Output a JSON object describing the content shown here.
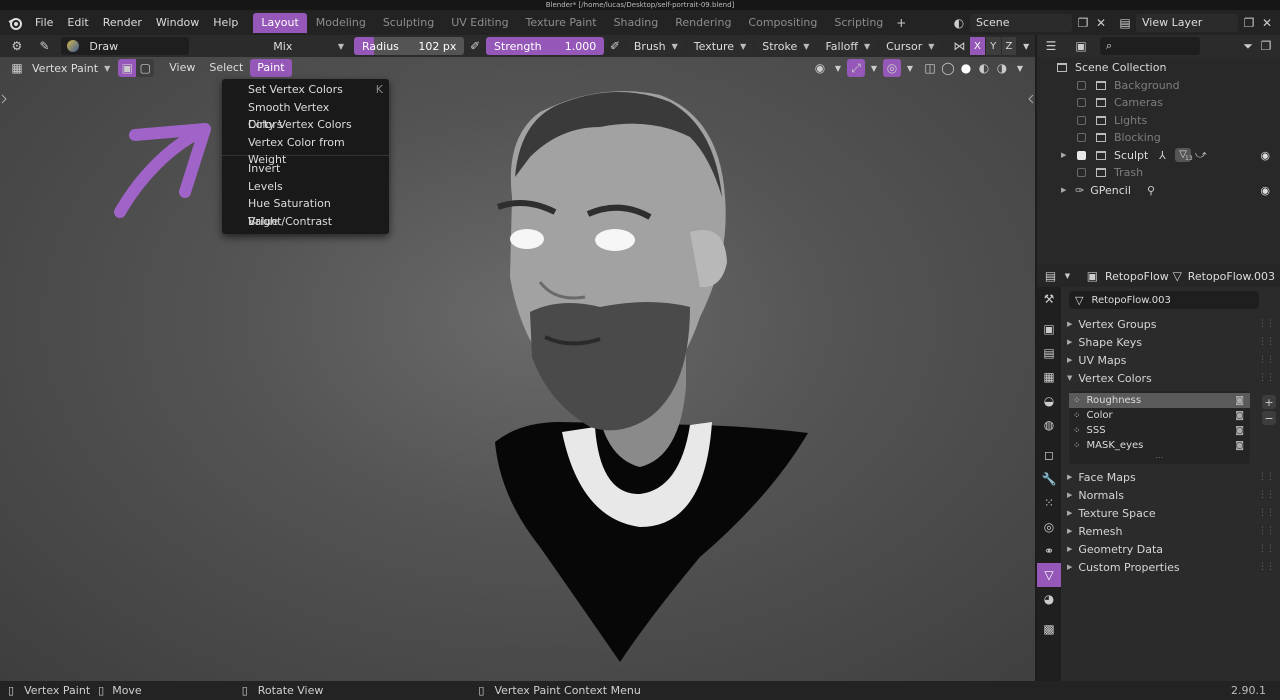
{
  "window": {
    "title": "Blender* [/home/lucas/Desktop/self-portrait-09.blend]"
  },
  "menu": [
    "File",
    "Edit",
    "Render",
    "Window",
    "Help"
  ],
  "workspaces": [
    "Layout",
    "Modeling",
    "Sculpting",
    "UV Editing",
    "Texture Paint",
    "Shading",
    "Rendering",
    "Compositing",
    "Scripting"
  ],
  "active_workspace": "Layout",
  "scene": {
    "name": "Scene",
    "view_layer": "View Layer"
  },
  "tool_settings": {
    "brush_name": "Draw",
    "blend": "Mix",
    "radius_label": "Radius",
    "radius_value": "102 px",
    "strength_label": "Strength",
    "strength_value": "1.000",
    "strength_fraction": 1.0,
    "menus": [
      "Brush",
      "Texture",
      "Stroke",
      "Falloff",
      "Cursor"
    ],
    "axes": [
      "X",
      "Y",
      "Z"
    ]
  },
  "viewport_header": {
    "mode": "Vertex Paint",
    "menus": [
      "View",
      "Select",
      "Paint"
    ],
    "active_menu": "Paint"
  },
  "paint_menu": {
    "items": [
      {
        "label": "Set Vertex Colors",
        "shortcut": "K"
      },
      {
        "label": "Smooth Vertex Colors",
        "shortcut": ""
      },
      {
        "label": "Dirty Vertex Colors",
        "shortcut": ""
      },
      {
        "label": "Vertex Color from Weight",
        "shortcut": ""
      },
      {
        "label": "Invert",
        "shortcut": ""
      },
      {
        "label": "Levels",
        "shortcut": ""
      },
      {
        "label": "Hue Saturation Value",
        "shortcut": ""
      },
      {
        "label": "Bright/Contrast",
        "shortcut": ""
      }
    ]
  },
  "outliner": {
    "root": "Scene Collection",
    "rows": [
      "Background",
      "Cameras",
      "Lights",
      "Blocking",
      "Sculpt",
      "Trash",
      "GPencil"
    ],
    "sculpt_badge": "13"
  },
  "properties": {
    "object_name": "RetopoFlow",
    "data_name": "RetopoFlow.003",
    "mesh_name": "RetopoFlow.003",
    "sections_top": [
      "Vertex Groups",
      "Shape Keys",
      "UV Maps",
      "Vertex Colors"
    ],
    "vertex_colors": [
      "Roughness",
      "Color",
      "SSS",
      "MASK_eyes"
    ],
    "sections_bottom": [
      "Face Maps",
      "Normals",
      "Texture Space",
      "Remesh",
      "Geometry Data",
      "Custom Properties"
    ]
  },
  "statusbar": {
    "items": [
      "Vertex Paint",
      "Move",
      "Rotate View",
      "Vertex Paint Context Menu"
    ],
    "version": "2.90.1"
  },
  "colors": {
    "accent": "#9558b8",
    "annotation_arrow": "#a064c8"
  }
}
